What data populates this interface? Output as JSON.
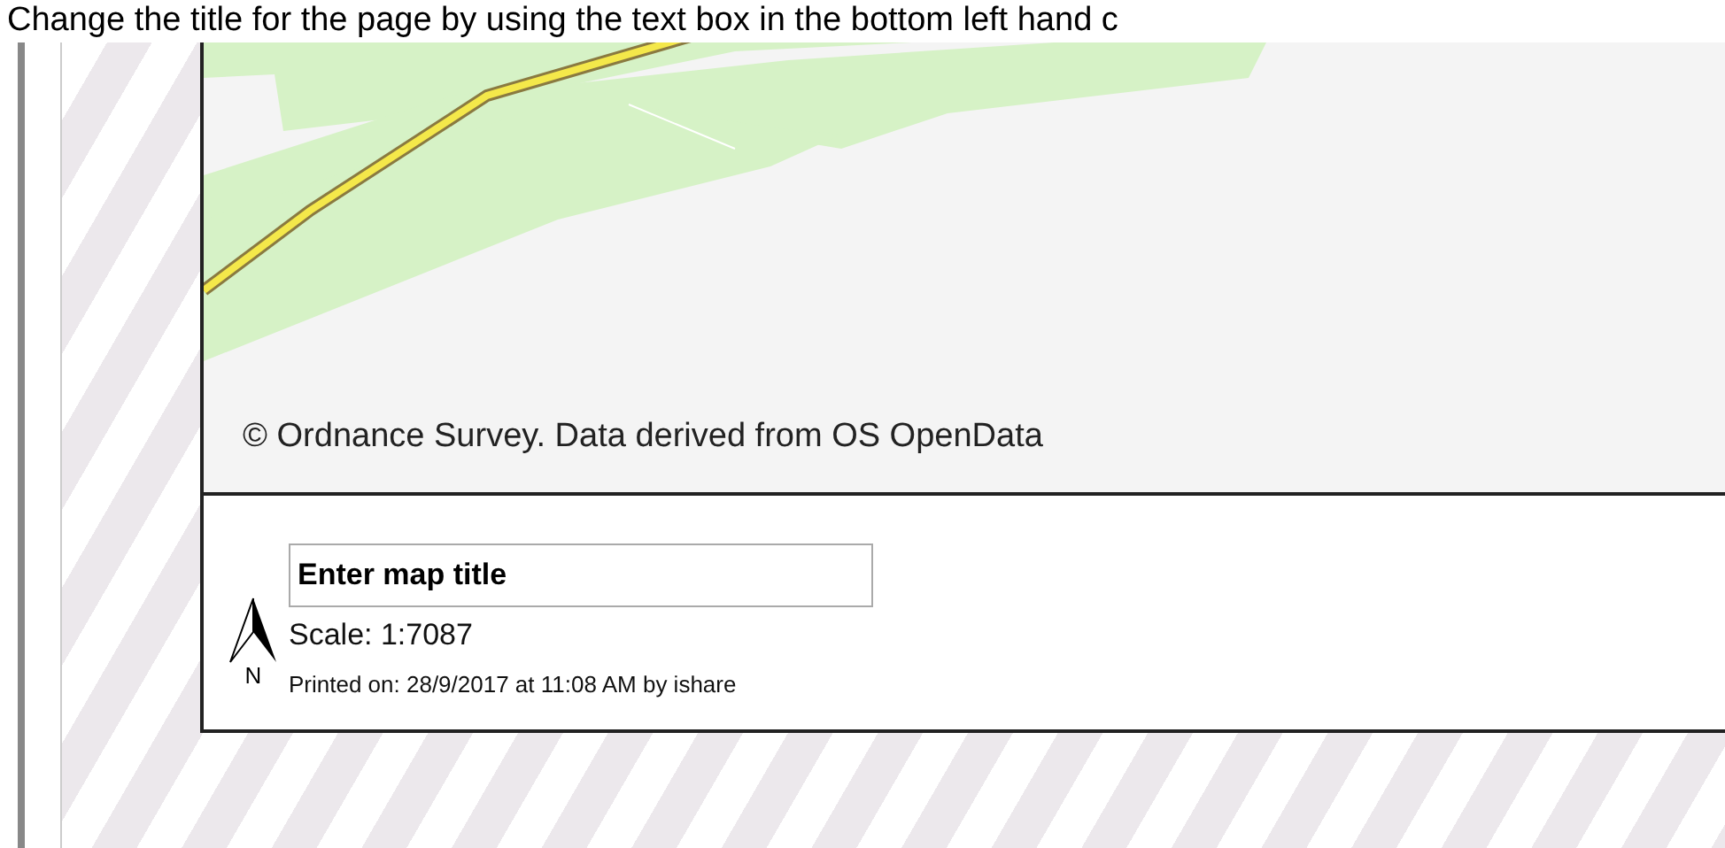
{
  "instruction": "Change the title for the page by using the text box in the bottom left hand c",
  "map": {
    "attribution": "© Ordnance Survey. Data derived from OS OpenData"
  },
  "legend": {
    "north_label": "N",
    "title_field": {
      "value": "Enter map title"
    },
    "scale": "Scale: 1:7087",
    "printed": "Printed on: 28/9/2017 at 11:08 AM by ishare"
  }
}
